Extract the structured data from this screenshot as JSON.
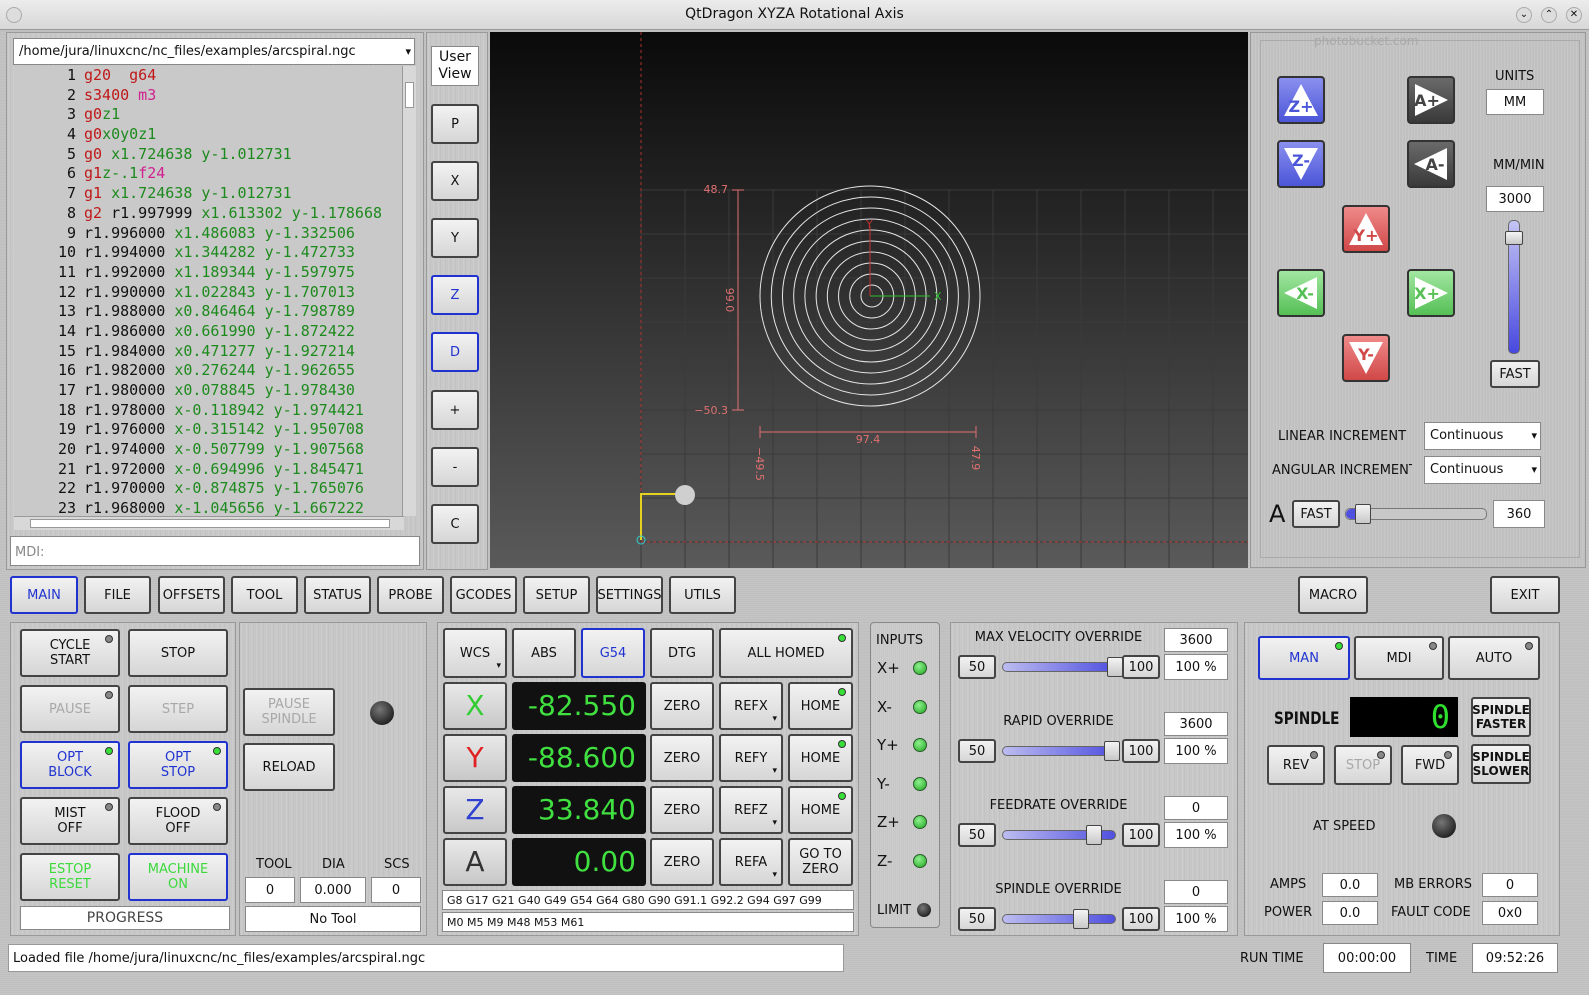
{
  "window": {
    "title": "QtDragon XYZA Rotational Axis"
  },
  "file_path": "/home/jura/linuxcnc/nc_files/examples/arcspiral.ngc",
  "code_lines": [
    {
      "n": "1",
      "t": [
        [
          "g",
          "g20"
        ],
        [
          "",
          "  "
        ],
        [
          "g",
          "g64"
        ]
      ]
    },
    {
      "n": "2",
      "t": [
        [
          "g",
          "s3400"
        ],
        [
          "",
          ""
        ],
        [
          "m",
          " m3"
        ]
      ]
    },
    {
      "n": "3",
      "t": [
        [
          "g",
          "g0"
        ],
        [
          "x",
          "z1"
        ]
      ]
    },
    {
      "n": "4",
      "t": [
        [
          "g",
          "g0"
        ],
        [
          "x",
          "x0"
        ],
        [
          "x",
          "y0"
        ],
        [
          "x",
          "z1"
        ]
      ]
    },
    {
      "n": "5",
      "t": [
        [
          "g",
          "g0"
        ],
        [
          "",
          " "
        ],
        [
          "x",
          "x1.724638"
        ],
        [
          "",
          " "
        ],
        [
          "x",
          "y-1.012731"
        ]
      ]
    },
    {
      "n": "6",
      "t": [
        [
          "g",
          "g1"
        ],
        [
          "x",
          "z-.1"
        ],
        [
          "m",
          "f24"
        ]
      ]
    },
    {
      "n": "7",
      "t": [
        [
          "g",
          "g1"
        ],
        [
          "",
          " "
        ],
        [
          "x",
          "x1.724638"
        ],
        [
          "",
          " "
        ],
        [
          "x",
          "y-1.012731"
        ]
      ]
    },
    {
      "n": "8",
      "t": [
        [
          "g",
          "g2"
        ],
        [
          "",
          " r1.997999 "
        ],
        [
          "x",
          "x1.613302"
        ],
        [
          "",
          " "
        ],
        [
          "x",
          "y-1.178668"
        ]
      ]
    },
    {
      "n": "9",
      "t": [
        [
          "",
          "r1.996000 "
        ],
        [
          "x",
          "x1.486083"
        ],
        [
          "",
          " "
        ],
        [
          "x",
          "y-1.332506"
        ]
      ]
    },
    {
      "n": "10",
      "t": [
        [
          "",
          "r1.994000 "
        ],
        [
          "x",
          "x1.344282"
        ],
        [
          "",
          " "
        ],
        [
          "x",
          "y-1.472733"
        ]
      ]
    },
    {
      "n": "11",
      "t": [
        [
          "",
          "r1.992000 "
        ],
        [
          "x",
          "x1.189344"
        ],
        [
          "",
          " "
        ],
        [
          "x",
          "y-1.597975"
        ]
      ]
    },
    {
      "n": "12",
      "t": [
        [
          "",
          "r1.990000 "
        ],
        [
          "x",
          "x1.022843"
        ],
        [
          "",
          " "
        ],
        [
          "x",
          "y-1.707013"
        ]
      ]
    },
    {
      "n": "13",
      "t": [
        [
          "",
          "r1.988000 "
        ],
        [
          "x",
          "x0.846464"
        ],
        [
          "",
          " "
        ],
        [
          "x",
          "y-1.798789"
        ]
      ]
    },
    {
      "n": "14",
      "t": [
        [
          "",
          "r1.986000 "
        ],
        [
          "x",
          "x0.661990"
        ],
        [
          "",
          " "
        ],
        [
          "x",
          "y-1.872422"
        ]
      ]
    },
    {
      "n": "15",
      "t": [
        [
          "",
          "r1.984000 "
        ],
        [
          "x",
          "x0.471277"
        ],
        [
          "",
          " "
        ],
        [
          "x",
          "y-1.927214"
        ]
      ]
    },
    {
      "n": "16",
      "t": [
        [
          "",
          "r1.982000 "
        ],
        [
          "x",
          "x0.276244"
        ],
        [
          "",
          " "
        ],
        [
          "x",
          "y-1.962655"
        ]
      ]
    },
    {
      "n": "17",
      "t": [
        [
          "",
          "r1.980000 "
        ],
        [
          "x",
          "x0.078845"
        ],
        [
          "",
          " "
        ],
        [
          "x",
          "y-1.978430"
        ]
      ]
    },
    {
      "n": "18",
      "t": [
        [
          "",
          "r1.978000 "
        ],
        [
          "x",
          "x-0.118942"
        ],
        [
          "",
          " "
        ],
        [
          "x",
          "y-1.974421"
        ]
      ]
    },
    {
      "n": "19",
      "t": [
        [
          "",
          "r1.976000 "
        ],
        [
          "x",
          "x-0.315142"
        ],
        [
          "",
          " "
        ],
        [
          "x",
          "y-1.950708"
        ]
      ]
    },
    {
      "n": "20",
      "t": [
        [
          "",
          "r1.974000 "
        ],
        [
          "x",
          "x-0.507799"
        ],
        [
          "",
          " "
        ],
        [
          "x",
          "y-1.907568"
        ]
      ]
    },
    {
      "n": "21",
      "t": [
        [
          "",
          "r1.972000 "
        ],
        [
          "x",
          "x-0.694996"
        ],
        [
          "",
          " "
        ],
        [
          "x",
          "y-1.845471"
        ]
      ]
    },
    {
      "n": "22",
      "t": [
        [
          "",
          "r1.970000 "
        ],
        [
          "x",
          "x-0.874875"
        ],
        [
          "",
          " "
        ],
        [
          "x",
          "y-1.765076"
        ]
      ]
    },
    {
      "n": "23",
      "t": [
        [
          "",
          "r1.968000 "
        ],
        [
          "x",
          "x-1.045656"
        ],
        [
          "",
          " "
        ],
        [
          "x",
          "y-1.667222"
        ]
      ]
    }
  ],
  "mdi_placeholder": "MDI:",
  "view_buttons": {
    "user_view": "User\nView",
    "p": "P",
    "x": "X",
    "y": "Y",
    "z": "Z",
    "d": "D",
    "plus": "+",
    "minus": "-",
    "c": "C"
  },
  "plot": {
    "ymax": "48.7",
    "ymin": "−50.3",
    "yspan": "99.0",
    "xspan": "97.4",
    "xmin": "−49.5",
    "xmax": "47.9",
    "axis_y": "Y",
    "axis_x": "X"
  },
  "jog": {
    "watermark": "photobucket.com",
    "units_label": "UNITS",
    "units_value": "MM",
    "rate_label": "MM/MIN",
    "rate_value": "3000",
    "fast": "FAST",
    "zplus": "Z+",
    "zminus": "Z-",
    "aplus": "A+",
    "aminus": "A-",
    "yplus": "Y+",
    "yminus": "Y-",
    "xminus": "X-",
    "xplus": "X+",
    "linear_label": "LINEAR INCREMENT",
    "linear_value": "Continuous",
    "angular_label": "ANGULAR INCREMENT",
    "angular_value": "Continuous",
    "a_label": "A",
    "a_fast": "FAST",
    "a_value": "360",
    "a_slider_frac": 0.05,
    "rate_slider_frac": 0.92
  },
  "tabs": [
    "MAIN",
    "FILE",
    "OFFSETS",
    "TOOL",
    "STATUS",
    "PROBE",
    "GCODES",
    "SETUP",
    "SETTINGS",
    "UTILS"
  ],
  "macro": "MACRO",
  "exit": "EXIT",
  "controls": {
    "cycle_start": "CYCLE\nSTART",
    "stop": "STOP",
    "pause": "PAUSE",
    "step": "STEP",
    "opt_block": "OPT\nBLOCK",
    "opt_stop": "OPT\nSTOP",
    "mist_off": "MIST\nOFF",
    "flood_off": "FLOOD\nOFF",
    "estop_reset": "ESTOP\nRESET",
    "machine_on": "MACHINE\nON",
    "progress": "PROGRESS",
    "pause_spindle": "PAUSE\nSPINDLE",
    "reload": "RELOAD",
    "tool_label": "TOOL",
    "dia_label": "DIA",
    "scs_label": "SCS",
    "tool_value": "0",
    "dia_value": "0.000",
    "scs_value": "0",
    "no_tool": "No Tool"
  },
  "dro": {
    "wcs": "WCS",
    "abs": "ABS",
    "g54": "G54",
    "dtg": "DTG",
    "all_homed": "ALL HOMED",
    "axes": [
      {
        "name": "X",
        "color": "#33cc33",
        "value": "-82.550",
        "ref": "REFX",
        "home": "HOME"
      },
      {
        "name": "Y",
        "color": "#e02020",
        "value": "-88.600",
        "ref": "REFY",
        "home": "HOME"
      },
      {
        "name": "Z",
        "color": "#3040d0",
        "value": "33.840",
        "ref": "REFZ",
        "home": "HOME"
      },
      {
        "name": "A",
        "color": "#333333",
        "value": "0.00",
        "ref": "REFA",
        "home": "GO TO\nZERO"
      }
    ],
    "zero": "ZERO",
    "gcodes": "G8 G17 G21 G40 G49 G54 G64 G80 G90 G91.1 G92.2 G94 G97 G99",
    "mcodes": "M0 M5 M9 M48 M53 M61"
  },
  "inputs": {
    "title": "INPUTS",
    "items": [
      "X+",
      "X-",
      "Y+",
      "Y-",
      "Z+",
      "Z-"
    ],
    "limit": "LIMIT"
  },
  "overrides": [
    {
      "label": "MAX VELOCITY OVERRIDE",
      "value": "3600",
      "pct": "100 %",
      "frac": 0.98
    },
    {
      "label": "RAPID OVERRIDE",
      "value": "3600",
      "pct": "100 %",
      "frac": 0.96
    },
    {
      "label": "FEEDRATE OVERRIDE",
      "value": "0",
      "pct": "100 %",
      "frac": 0.8
    },
    {
      "label": "SPINDLE OVERRIDE",
      "value": "0",
      "pct": "100 %",
      "frac": 0.68
    }
  ],
  "ov_low": "50",
  "ov_high": "100",
  "spindle": {
    "man": "MAN",
    "mdi": "MDI",
    "auto": "AUTO",
    "label": "SPINDLE",
    "display": "0",
    "faster": "SPINDLE\nFASTER",
    "slower": "SPINDLE\nSLOWER",
    "rev": "REV",
    "stop": "STOP",
    "fwd": "FWD",
    "at_speed": "AT SPEED",
    "amps_label": "AMPS",
    "amps": "0.0",
    "power_label": "POWER",
    "power": "0.0",
    "mb_label": "MB ERRORS",
    "mb": "0",
    "fault_label": "FAULT CODE",
    "fault": "0x0"
  },
  "status": {
    "message": "Loaded file /home/jura/linuxcnc/nc_files/examples/arcspiral.ngc",
    "run_label": "RUN TIME",
    "run": "00:00:00",
    "time_label": "TIME",
    "time": "09:52:26"
  }
}
